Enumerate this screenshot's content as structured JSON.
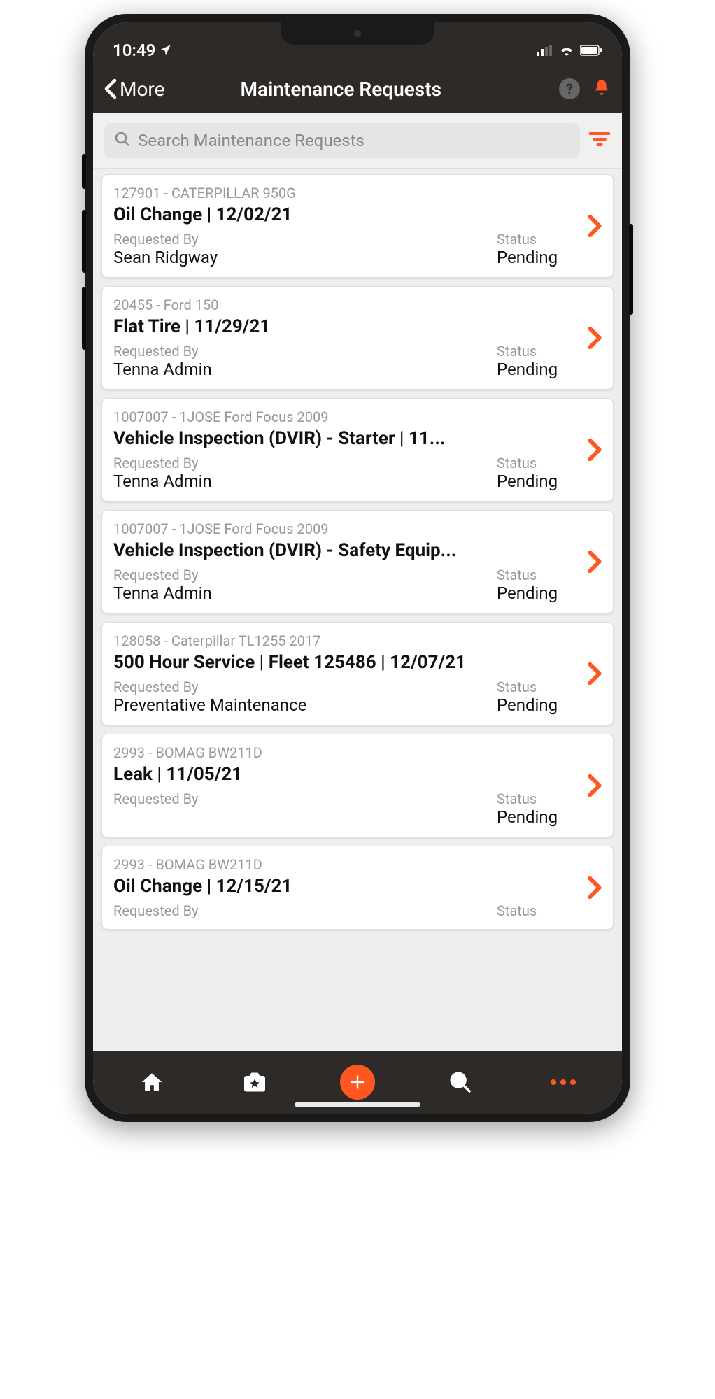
{
  "statusbar": {
    "time": "10:49"
  },
  "header": {
    "back_label": "More",
    "title": "Maintenance Requests"
  },
  "search": {
    "placeholder": "Search Maintenance Requests"
  },
  "labels": {
    "requested_by": "Requested By",
    "status": "Status"
  },
  "requests": [
    {
      "asset": "127901 - CATERPILLAR 950G",
      "title": "Oil Change | 12/02/21",
      "requested_by": "Sean Ridgway",
      "status": "Pending"
    },
    {
      "asset": "20455 - Ford 150",
      "title": "Flat Tire | 11/29/21",
      "requested_by": "Tenna Admin",
      "status": "Pending"
    },
    {
      "asset": "1007007 - 1JOSE Ford Focus 2009",
      "title": "Vehicle Inspection (DVIR)  - Starter | 11...",
      "requested_by": "Tenna Admin",
      "status": "Pending"
    },
    {
      "asset": "1007007 - 1JOSE Ford Focus 2009",
      "title": "Vehicle Inspection (DVIR)  - Safety Equip...",
      "requested_by": "Tenna Admin",
      "status": "Pending"
    },
    {
      "asset": "128058 - Caterpillar TL1255 2017",
      "title": "500 Hour Service | Fleet 125486 | 12/07/21",
      "requested_by": "Preventative Maintenance",
      "status": "Pending"
    },
    {
      "asset": "2993 - BOMAG BW211D",
      "title": "Leak | 11/05/21",
      "requested_by": "",
      "status": "Pending"
    },
    {
      "asset": "2993 - BOMAG BW211D",
      "title": "Oil Change | 12/15/21",
      "requested_by": "",
      "status": ""
    }
  ]
}
